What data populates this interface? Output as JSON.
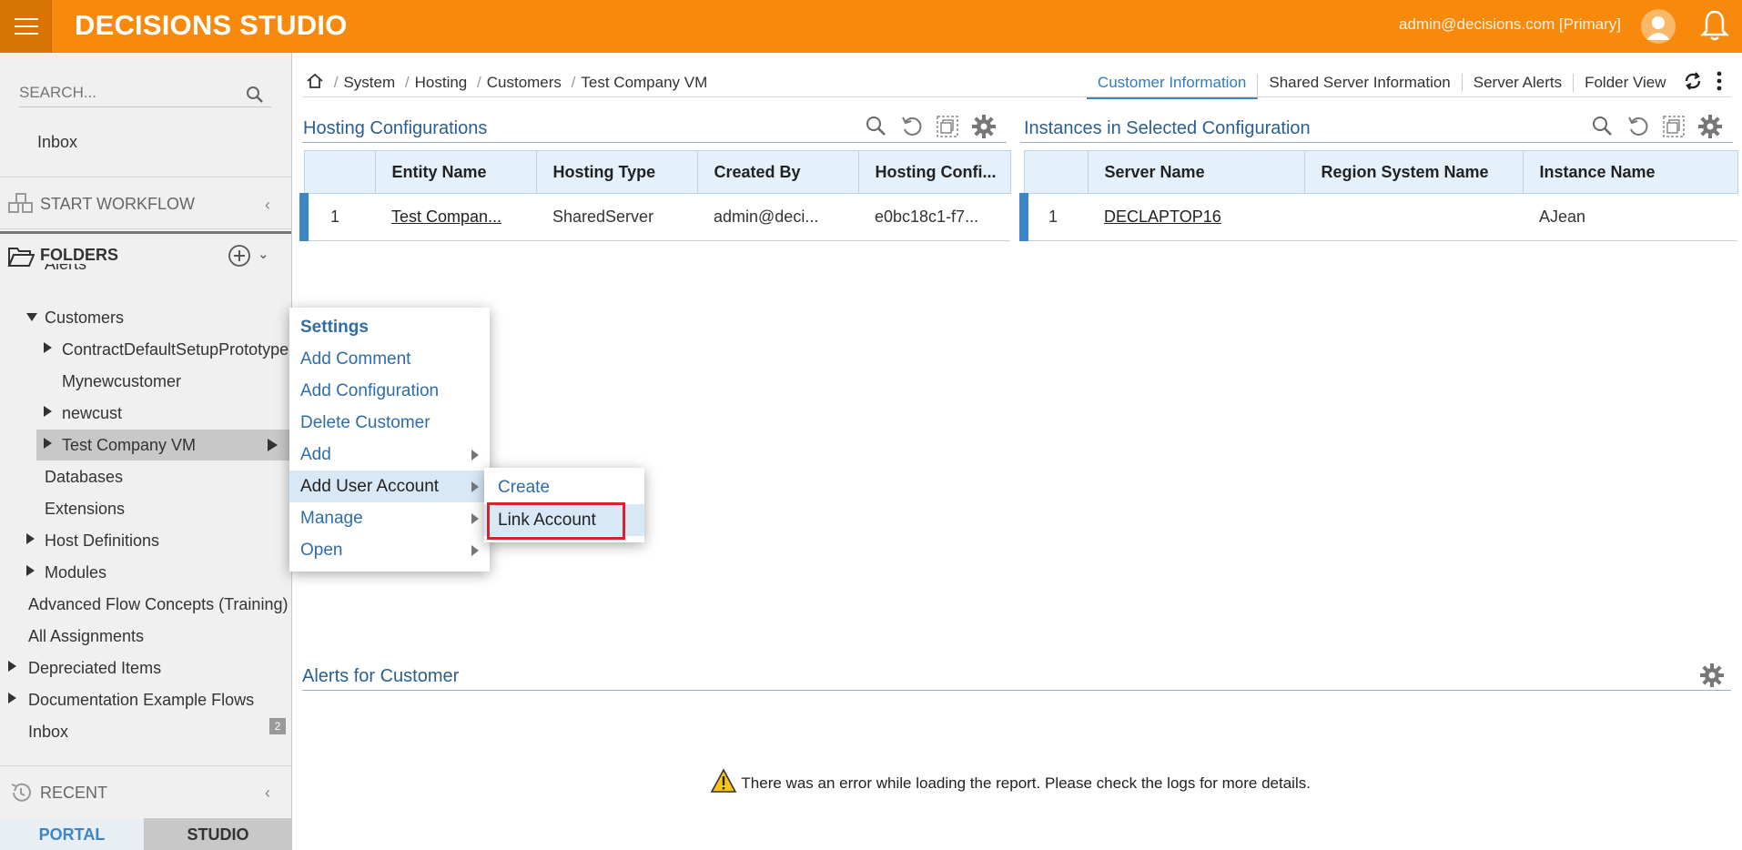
{
  "app": {
    "title": "DECISIONS STUDIO",
    "user": "admin@decisions.com [Primary]"
  },
  "sidebar": {
    "search_placeholder": "SEARCH...",
    "inbox": "Inbox",
    "start_workflow": "START WORKFLOW",
    "folders": "FOLDERS",
    "recent": "RECENT",
    "tree": [
      {
        "label": "Alerts"
      },
      {
        "label": "Customers"
      },
      {
        "label": "ContractDefaultSetupPrototype"
      },
      {
        "label": "Mynewcustomer"
      },
      {
        "label": "newcust"
      },
      {
        "label": "Test Company VM"
      },
      {
        "label": "Databases"
      },
      {
        "label": "Extensions"
      },
      {
        "label": "Host Definitions"
      },
      {
        "label": "Modules"
      },
      {
        "label": "Advanced Flow Concepts (Training)"
      },
      {
        "label": "All Assignments"
      },
      {
        "label": "Depreciated Items"
      },
      {
        "label": "Documentation Example Flows"
      },
      {
        "label": "Inbox",
        "badge": "2"
      }
    ],
    "tabs": {
      "portal": "PORTAL",
      "studio": "STUDIO"
    }
  },
  "breadcrumb": [
    "System",
    "Hosting",
    "Customers",
    "Test Company VM"
  ],
  "tabs": [
    "Customer Information",
    "Shared Server Information",
    "Server Alerts",
    "Folder View"
  ],
  "hosting": {
    "title": "Hosting Configurations",
    "columns": [
      "Entity Name",
      "Hosting Type",
      "Created By",
      "Hosting Confi..."
    ],
    "rows": [
      {
        "num": "1",
        "entity": "Test Compan...",
        "type": "SharedServer",
        "created_by": "admin@deci...",
        "config": "e0bc18c1-f7..."
      }
    ]
  },
  "instances": {
    "title": "Instances in Selected Configuration",
    "columns": [
      "Server Name",
      "Region System Name",
      "Instance Name"
    ],
    "rows": [
      {
        "num": "1",
        "server": "DECLAPTOP16",
        "region": "",
        "instance": "AJean"
      }
    ]
  },
  "alerts": {
    "title": "Alerts for Customer",
    "error": "There was an error while loading the report. Please check the logs for more details."
  },
  "context_menu": {
    "items": [
      "Settings",
      "Add Comment",
      "Add Configuration",
      "Delete Customer",
      "Add",
      "Add User Account",
      "Manage",
      "Open"
    ],
    "submenu": [
      "Create",
      "Link Account"
    ]
  },
  "colors": {
    "topbar": "#f78a0c",
    "accent": "#3d86c6",
    "link": "#2f6da6"
  }
}
